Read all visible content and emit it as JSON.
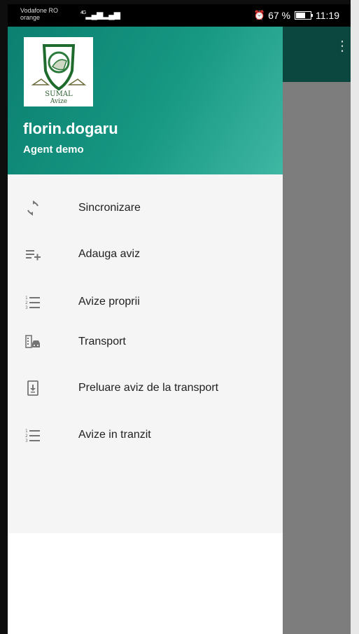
{
  "status_bar": {
    "carrier_line1": "Vodafone RO",
    "carrier_line2": "orange",
    "network_type": "4G",
    "battery_percent": "67 %",
    "battery_level": 0.67,
    "time": "11:19",
    "alarm_icon": "alarm-icon"
  },
  "app_bar": {
    "overflow_icon": "more-vert-icon"
  },
  "drawer": {
    "logo": {
      "line1": "SUMAL",
      "line2": "Avize"
    },
    "user": {
      "name": "florin.dogaru",
      "role": "Agent demo"
    },
    "items": [
      {
        "label": "Sincronizare",
        "icon": "sync-icon"
      },
      {
        "label": "Adauga aviz",
        "icon": "playlist-add-icon"
      },
      {
        "label": "Avize proprii",
        "icon": "numbered-list-icon"
      },
      {
        "label": "Transport",
        "icon": "transport-icon"
      },
      {
        "label": "Preluare aviz de la transport",
        "icon": "download-box-icon"
      },
      {
        "label": "Avize in tranzit",
        "icon": "numbered-list-icon"
      }
    ]
  },
  "colors": {
    "header_gradient_start": "#0c7f70",
    "header_gradient_end": "#3fb7a3",
    "app_bar": "#0b463f",
    "scrim": "#7d7d7d",
    "icon": "#757575"
  }
}
